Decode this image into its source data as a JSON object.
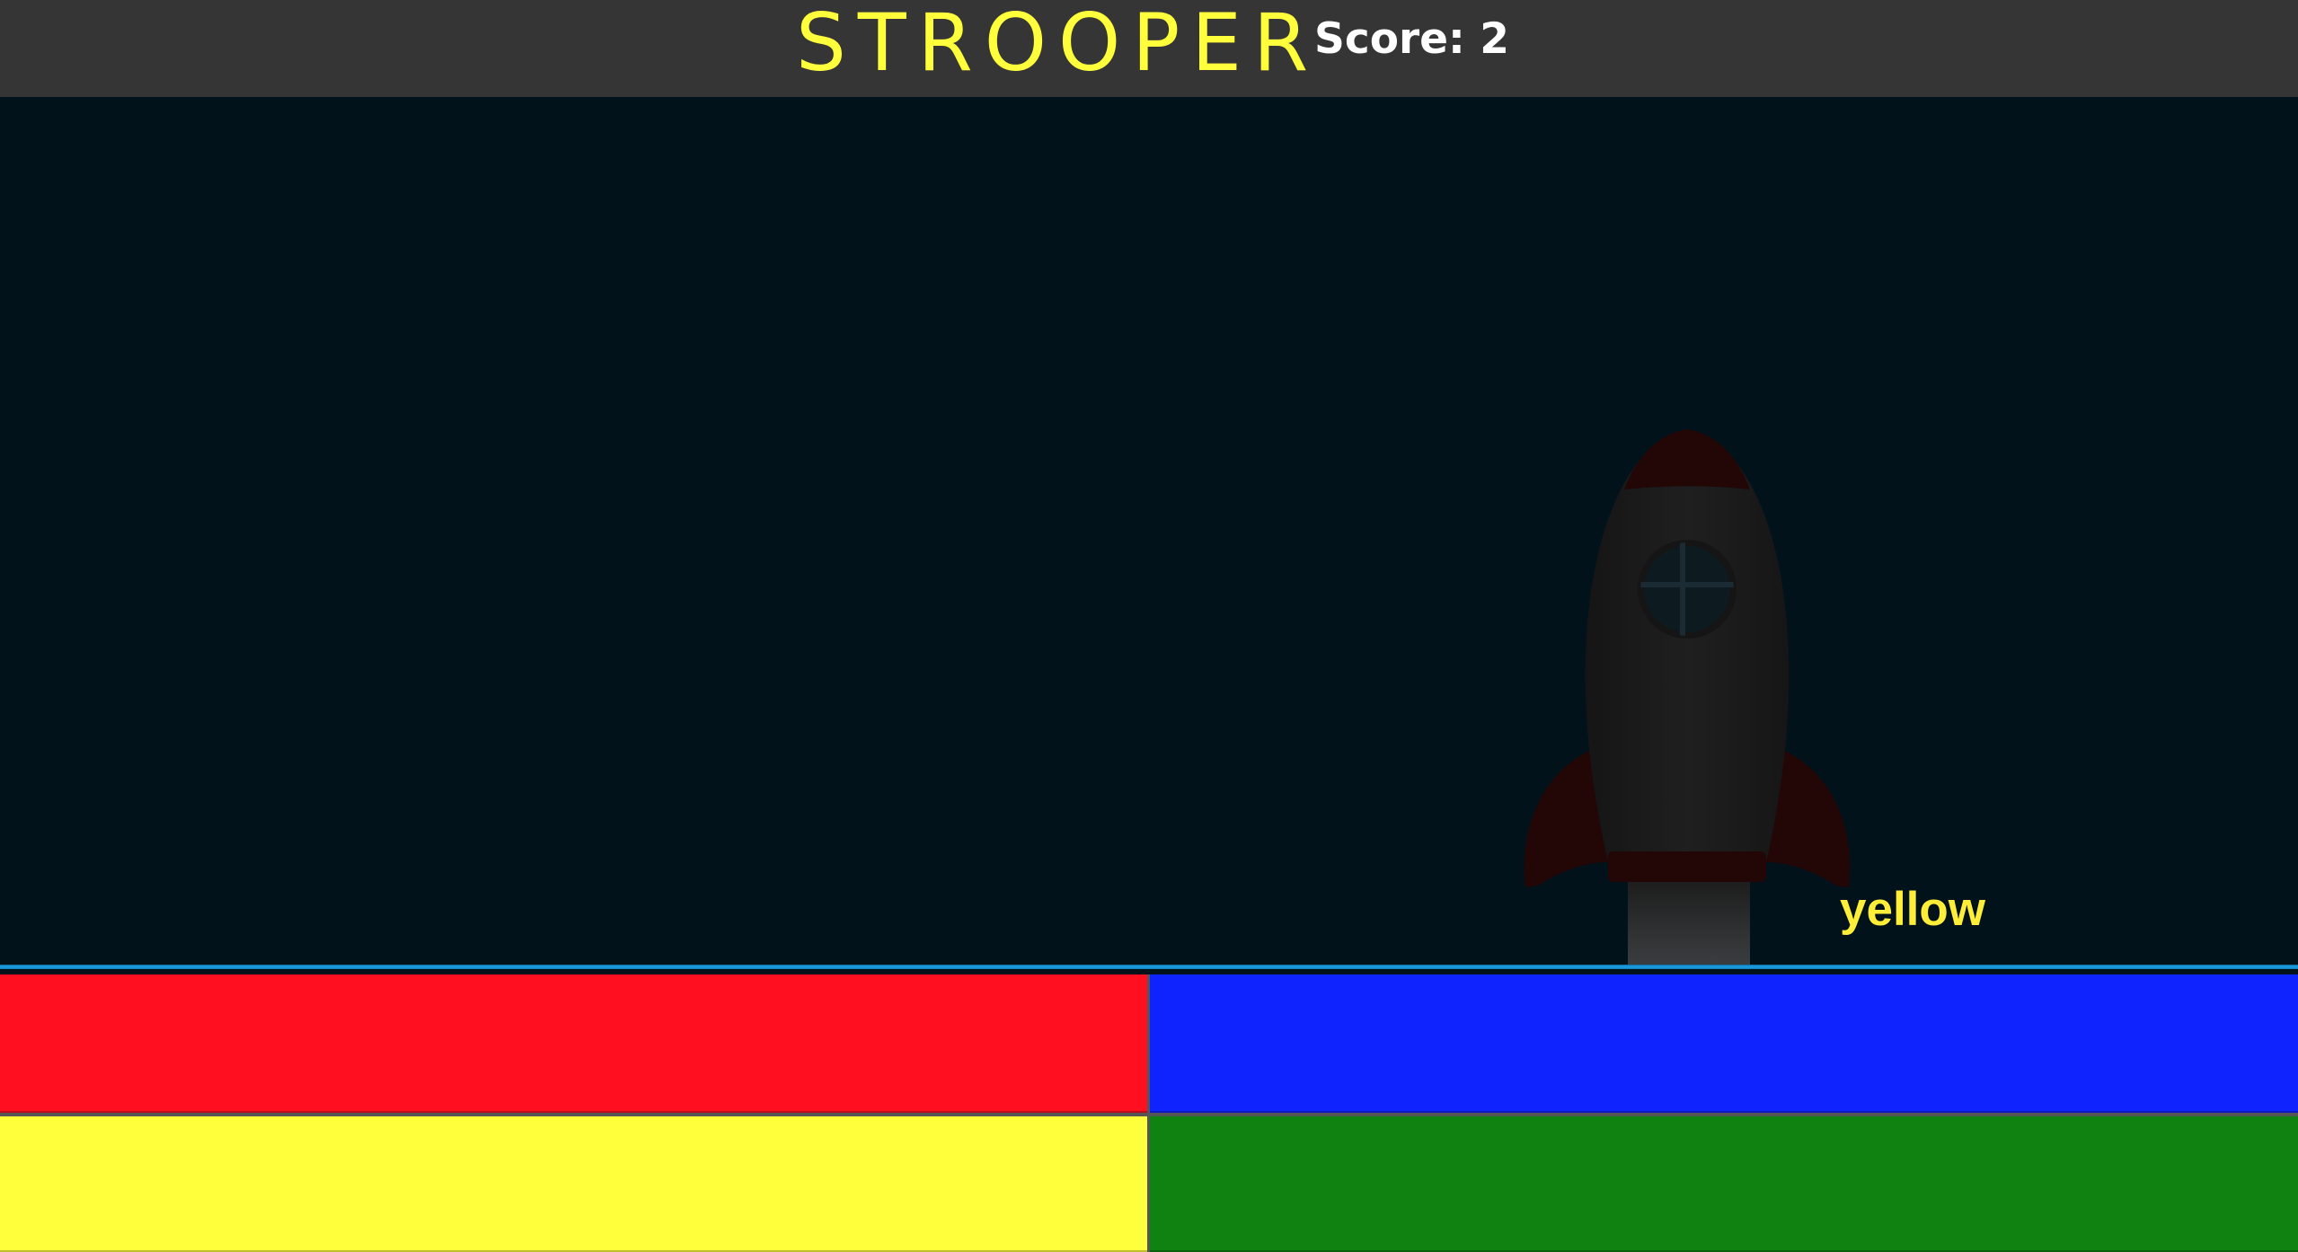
{
  "header": {
    "title": "STROOPER",
    "title_color": "#ffff3c",
    "score_text": "Score: 2"
  },
  "game": {
    "word": "yellow",
    "word_color": "#ffee38",
    "scene": {
      "background_color": "#02121a",
      "ground_color": "#1fa3e6",
      "rocket_body_color": "#1c1c1c",
      "rocket_accent_color": "#230606",
      "icon": "rocket-icon"
    }
  },
  "buttons": [
    {
      "name": "red",
      "color": "#ff0f1f"
    },
    {
      "name": "blue",
      "color": "#0f23ff"
    },
    {
      "name": "yellow",
      "color": "#ffff3c"
    },
    {
      "name": "green",
      "color": "#108212"
    }
  ]
}
